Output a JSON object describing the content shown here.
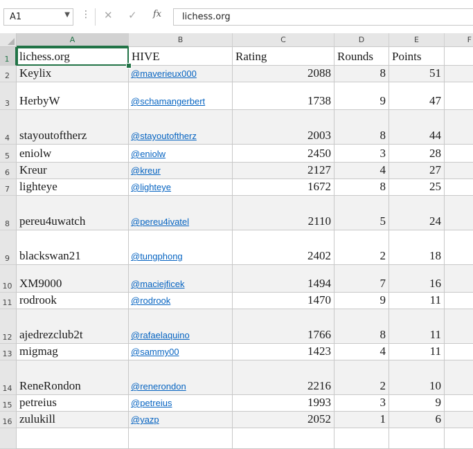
{
  "formula_bar": {
    "name_box": "A1",
    "formula": "lichess.org",
    "fx_label": "fx",
    "cancel_glyph": "✕",
    "enter_glyph": "✓",
    "more_glyph": "⋮"
  },
  "columns": [
    "A",
    "B",
    "C",
    "D",
    "E",
    "F"
  ],
  "rows": [
    {
      "n": "1",
      "a": "lichess.org",
      "b": "HIVE",
      "c": "Rating",
      "d": "Rounds",
      "e": "Points",
      "header": true
    },
    {
      "n": "2",
      "a": "Keylix",
      "b": "@maverieux000",
      "c": "2088",
      "d": "8",
      "e": "51"
    },
    {
      "n": "3",
      "a": "HerbyW",
      "b": "@schamangerbert",
      "c": "1738",
      "d": "9",
      "e": "47"
    },
    {
      "n": "4",
      "a": "stayoutoftherz",
      "b": "@stayoutoftherz",
      "c": "2003",
      "d": "8",
      "e": "44"
    },
    {
      "n": "5",
      "a": "eniolw",
      "b": "@eniolw",
      "c": "2450",
      "d": "3",
      "e": "28"
    },
    {
      "n": "6",
      "a": "Kreur",
      "b": "@kreur",
      "c": "2127",
      "d": "4",
      "e": "27"
    },
    {
      "n": "7",
      "a": "lighteye",
      "b": "@lighteye",
      "c": "1672",
      "d": "8",
      "e": "25"
    },
    {
      "n": "8",
      "a": "pereu4uwatch",
      "b": "@pereu4ivatel",
      "c": "2110",
      "d": "5",
      "e": "24"
    },
    {
      "n": "9",
      "a": "blackswan21",
      "b": "@tungphong",
      "c": "2402",
      "d": "2",
      "e": "18"
    },
    {
      "n": "10",
      "a": "XM9000",
      "b": "@maciejficek",
      "c": "1494",
      "d": "7",
      "e": "16"
    },
    {
      "n": "11",
      "a": "rodrook",
      "b": "@rodrook",
      "c": "1470",
      "d": "9",
      "e": "11"
    },
    {
      "n": "12",
      "a": "ajedrezclub2t",
      "b": "@rafaelaquino",
      "c": "1766",
      "d": "8",
      "e": "11"
    },
    {
      "n": "13",
      "a": "migmag",
      "b": "@sammy00",
      "c": "1423",
      "d": "4",
      "e": "11"
    },
    {
      "n": "14",
      "a": "ReneRondon",
      "b": "@renerondon",
      "c": "2216",
      "d": "2",
      "e": "10"
    },
    {
      "n": "15",
      "a": "petreius",
      "b": "@petreius",
      "c": "1993",
      "d": "3",
      "e": "9"
    },
    {
      "n": "16",
      "a": "zulukill",
      "b": "@yazp",
      "c": "2052",
      "d": "1",
      "e": "6"
    },
    {
      "n": "",
      "a": "",
      "b": "",
      "c": "",
      "d": "",
      "e": ""
    }
  ],
  "colors": {
    "accent": "#217346",
    "link": "#0563c1",
    "banded_row": "#f2f2f2"
  }
}
